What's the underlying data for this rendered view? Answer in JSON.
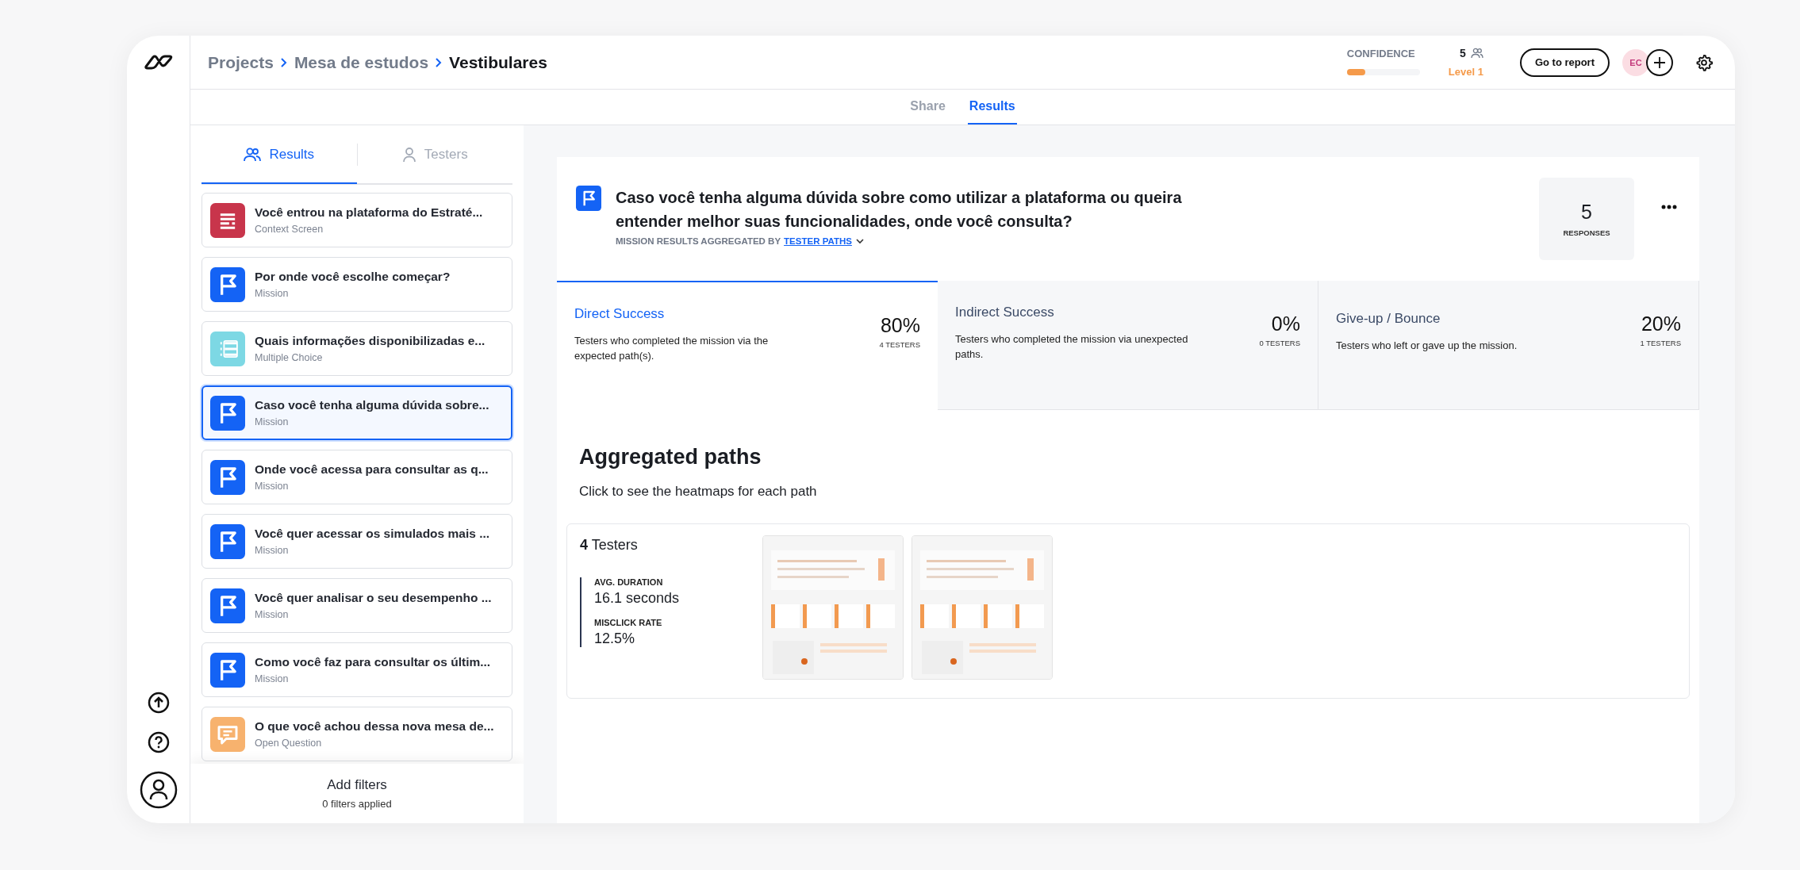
{
  "breadcrumb": [
    "Projects",
    "Mesa de estudos",
    "Vestibulares"
  ],
  "confidence": {
    "label": "CONFIDENCE",
    "count": "5",
    "level": 0.25,
    "level_label": "Level 1"
  },
  "report_button": "Go to report",
  "avatar": "EC",
  "tabs": [
    {
      "label": "Share",
      "selected": false
    },
    {
      "label": "Results",
      "selected": true
    }
  ],
  "panel_tabs": [
    {
      "label": "Results",
      "selected": true
    },
    {
      "label": "Testers",
      "selected": false
    }
  ],
  "questions": [
    {
      "title": "Você entrou na plataforma do Estraté...",
      "type": "Context Screen",
      "kind": "context",
      "selected": false
    },
    {
      "title": "Por onde você escolhe começar?",
      "type": "Mission",
      "kind": "mission",
      "selected": false
    },
    {
      "title": "Quais informações disponibilizadas e...",
      "type": "Multiple Choice",
      "kind": "choice",
      "selected": false
    },
    {
      "title": "Caso você tenha alguma dúvida sobre...",
      "type": "Mission",
      "kind": "mission",
      "selected": true
    },
    {
      "title": "Onde você acessa para consultar as q...",
      "type": "Mission",
      "kind": "mission",
      "selected": false
    },
    {
      "title": "Você quer acessar os simulados mais ...",
      "type": "Mission",
      "kind": "mission",
      "selected": false
    },
    {
      "title": "Você quer analisar o seu desempenho ...",
      "type": "Mission",
      "kind": "mission",
      "selected": false
    },
    {
      "title": "Como você faz para consultar os últim...",
      "type": "Mission",
      "kind": "mission",
      "selected": false
    },
    {
      "title": "O que você achou dessa nova mesa de...",
      "type": "Open Question",
      "kind": "open",
      "selected": false
    }
  ],
  "filters": {
    "title": "Add filters",
    "subtitle": "0 filters applied"
  },
  "mission": {
    "title": "Caso você tenha alguma dúvida sobre como utilizar a plataforma ou queira entender melhor suas funcionalidades, onde você consulta?",
    "aggregated_label": "MISSION RESULTS AGGREGATED BY",
    "aggregated_link": "TESTER PATHS",
    "responses": "5",
    "responses_label": "RESPONSES"
  },
  "outcomes": [
    {
      "title": "Direct Success",
      "description": "Testers who completed the mission via the expected path(s).",
      "percent": "80%",
      "testers": "4 TESTERS",
      "selected": true
    },
    {
      "title": "Indirect Success",
      "description": "Testers who completed the mission via unexpected paths.",
      "percent": "0%",
      "testers": "0 TESTERS",
      "selected": false
    },
    {
      "title": "Give-up / Bounce",
      "description": "Testers who left or gave up the mission.",
      "percent": "20%",
      "testers": "1 TESTERS",
      "selected": false
    }
  ],
  "aggregated": {
    "title": "Aggregated paths",
    "subtitle": "Click to see the heatmaps for each path",
    "paths": [
      {
        "count": "4",
        "count_label": "Testers",
        "stats": [
          {
            "label": "AVG. DURATION",
            "value": "16.1 seconds"
          },
          {
            "label": "MISCLICK RATE",
            "value": "12.5%"
          }
        ],
        "thumbnails": [
          {
            "kind": "picture"
          },
          {
            "kind": "picture"
          }
        ]
      }
    ]
  }
}
